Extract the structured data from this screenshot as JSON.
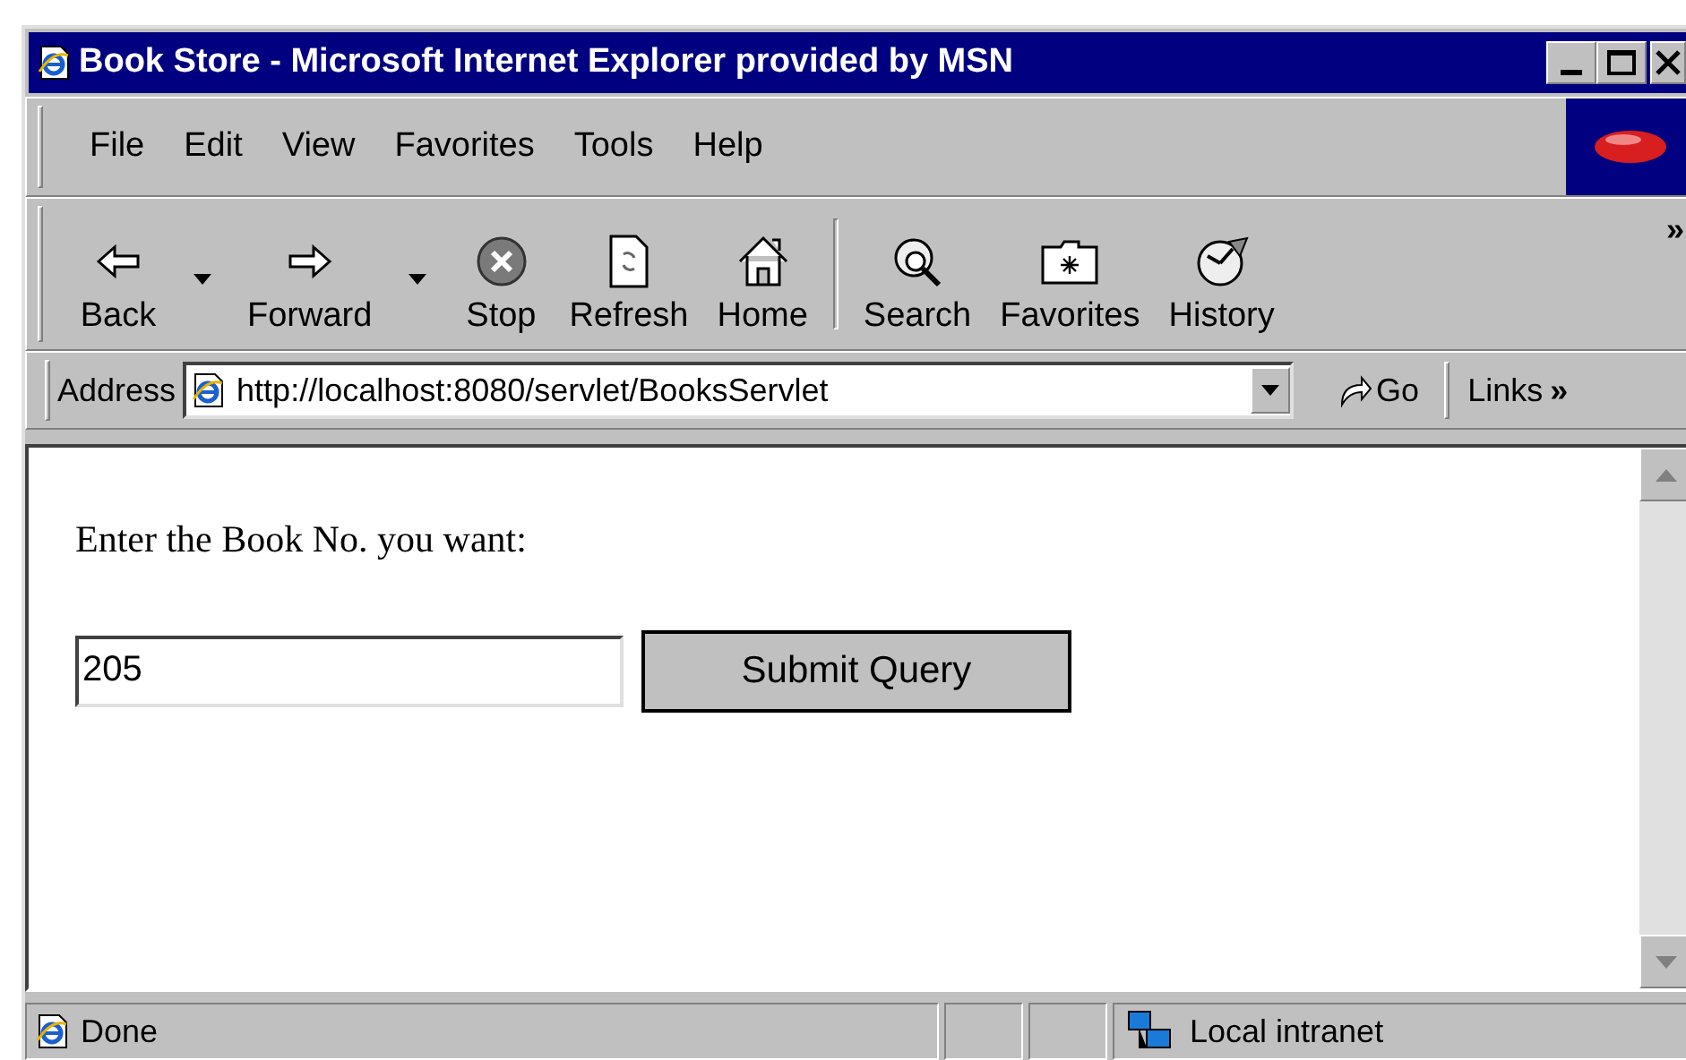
{
  "window": {
    "title": "Book Store - Microsoft Internet Explorer provided by MSN"
  },
  "menu": [
    {
      "label": "File"
    },
    {
      "label": "Edit"
    },
    {
      "label": "View"
    },
    {
      "label": "Favorites"
    },
    {
      "label": "Tools"
    },
    {
      "label": "Help"
    }
  ],
  "toolbar": [
    {
      "label": "Back",
      "kind": "back",
      "dropdown": true
    },
    {
      "label": "Forward",
      "kind": "forward",
      "dropdown": true
    },
    {
      "label": "Stop",
      "kind": "stop",
      "dropdown": false
    },
    {
      "label": "Refresh",
      "kind": "refresh",
      "dropdown": false
    },
    {
      "label": "Home",
      "kind": "home",
      "dropdown": false
    },
    {
      "label": "Search",
      "kind": "search",
      "dropdown": false
    },
    {
      "label": "Favorites",
      "kind": "favorites",
      "dropdown": false
    },
    {
      "label": "History",
      "kind": "history",
      "dropdown": false
    }
  ],
  "toolbar_more": "»",
  "address": {
    "label": "Address",
    "value": "http://localhost:8080/servlet/BooksServlet",
    "go": "Go",
    "links": "Links",
    "links_more": "»"
  },
  "page": {
    "prompt": "Enter the Book No. you want:",
    "field_value": "205",
    "button": "Submit Query"
  },
  "status_bar": {
    "text": "Done",
    "zone": "Local intranet"
  }
}
